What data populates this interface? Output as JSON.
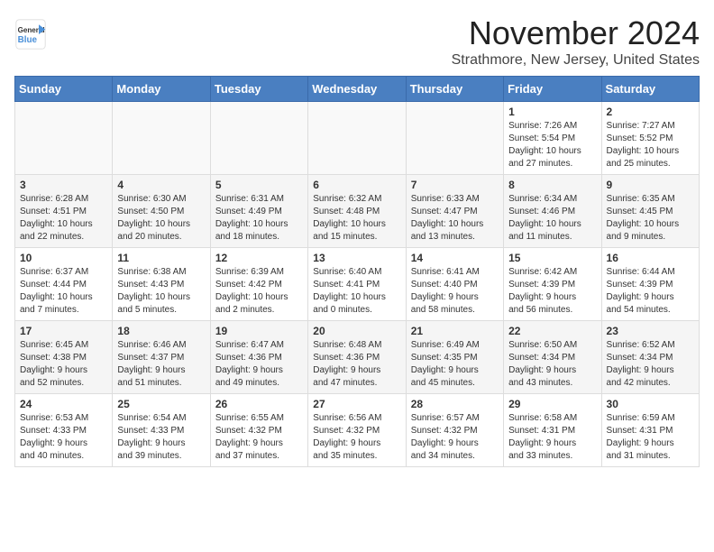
{
  "header": {
    "logo": {
      "line1": "General",
      "line2": "Blue"
    },
    "title": "November 2024",
    "subtitle": "Strathmore, New Jersey, United States"
  },
  "calendar": {
    "weekdays": [
      "Sunday",
      "Monday",
      "Tuesday",
      "Wednesday",
      "Thursday",
      "Friday",
      "Saturday"
    ],
    "weeks": [
      [
        {
          "day": "",
          "info": ""
        },
        {
          "day": "",
          "info": ""
        },
        {
          "day": "",
          "info": ""
        },
        {
          "day": "",
          "info": ""
        },
        {
          "day": "",
          "info": ""
        },
        {
          "day": "1",
          "info": "Sunrise: 7:26 AM\nSunset: 5:54 PM\nDaylight: 10 hours\nand 27 minutes."
        },
        {
          "day": "2",
          "info": "Sunrise: 7:27 AM\nSunset: 5:52 PM\nDaylight: 10 hours\nand 25 minutes."
        }
      ],
      [
        {
          "day": "3",
          "info": "Sunrise: 6:28 AM\nSunset: 4:51 PM\nDaylight: 10 hours\nand 22 minutes."
        },
        {
          "day": "4",
          "info": "Sunrise: 6:30 AM\nSunset: 4:50 PM\nDaylight: 10 hours\nand 20 minutes."
        },
        {
          "day": "5",
          "info": "Sunrise: 6:31 AM\nSunset: 4:49 PM\nDaylight: 10 hours\nand 18 minutes."
        },
        {
          "day": "6",
          "info": "Sunrise: 6:32 AM\nSunset: 4:48 PM\nDaylight: 10 hours\nand 15 minutes."
        },
        {
          "day": "7",
          "info": "Sunrise: 6:33 AM\nSunset: 4:47 PM\nDaylight: 10 hours\nand 13 minutes."
        },
        {
          "day": "8",
          "info": "Sunrise: 6:34 AM\nSunset: 4:46 PM\nDaylight: 10 hours\nand 11 minutes."
        },
        {
          "day": "9",
          "info": "Sunrise: 6:35 AM\nSunset: 4:45 PM\nDaylight: 10 hours\nand 9 minutes."
        }
      ],
      [
        {
          "day": "10",
          "info": "Sunrise: 6:37 AM\nSunset: 4:44 PM\nDaylight: 10 hours\nand 7 minutes."
        },
        {
          "day": "11",
          "info": "Sunrise: 6:38 AM\nSunset: 4:43 PM\nDaylight: 10 hours\nand 5 minutes."
        },
        {
          "day": "12",
          "info": "Sunrise: 6:39 AM\nSunset: 4:42 PM\nDaylight: 10 hours\nand 2 minutes."
        },
        {
          "day": "13",
          "info": "Sunrise: 6:40 AM\nSunset: 4:41 PM\nDaylight: 10 hours\nand 0 minutes."
        },
        {
          "day": "14",
          "info": "Sunrise: 6:41 AM\nSunset: 4:40 PM\nDaylight: 9 hours\nand 58 minutes."
        },
        {
          "day": "15",
          "info": "Sunrise: 6:42 AM\nSunset: 4:39 PM\nDaylight: 9 hours\nand 56 minutes."
        },
        {
          "day": "16",
          "info": "Sunrise: 6:44 AM\nSunset: 4:39 PM\nDaylight: 9 hours\nand 54 minutes."
        }
      ],
      [
        {
          "day": "17",
          "info": "Sunrise: 6:45 AM\nSunset: 4:38 PM\nDaylight: 9 hours\nand 52 minutes."
        },
        {
          "day": "18",
          "info": "Sunrise: 6:46 AM\nSunset: 4:37 PM\nDaylight: 9 hours\nand 51 minutes."
        },
        {
          "day": "19",
          "info": "Sunrise: 6:47 AM\nSunset: 4:36 PM\nDaylight: 9 hours\nand 49 minutes."
        },
        {
          "day": "20",
          "info": "Sunrise: 6:48 AM\nSunset: 4:36 PM\nDaylight: 9 hours\nand 47 minutes."
        },
        {
          "day": "21",
          "info": "Sunrise: 6:49 AM\nSunset: 4:35 PM\nDaylight: 9 hours\nand 45 minutes."
        },
        {
          "day": "22",
          "info": "Sunrise: 6:50 AM\nSunset: 4:34 PM\nDaylight: 9 hours\nand 43 minutes."
        },
        {
          "day": "23",
          "info": "Sunrise: 6:52 AM\nSunset: 4:34 PM\nDaylight: 9 hours\nand 42 minutes."
        }
      ],
      [
        {
          "day": "24",
          "info": "Sunrise: 6:53 AM\nSunset: 4:33 PM\nDaylight: 9 hours\nand 40 minutes."
        },
        {
          "day": "25",
          "info": "Sunrise: 6:54 AM\nSunset: 4:33 PM\nDaylight: 9 hours\nand 39 minutes."
        },
        {
          "day": "26",
          "info": "Sunrise: 6:55 AM\nSunset: 4:32 PM\nDaylight: 9 hours\nand 37 minutes."
        },
        {
          "day": "27",
          "info": "Sunrise: 6:56 AM\nSunset: 4:32 PM\nDaylight: 9 hours\nand 35 minutes."
        },
        {
          "day": "28",
          "info": "Sunrise: 6:57 AM\nSunset: 4:32 PM\nDaylight: 9 hours\nand 34 minutes."
        },
        {
          "day": "29",
          "info": "Sunrise: 6:58 AM\nSunset: 4:31 PM\nDaylight: 9 hours\nand 33 minutes."
        },
        {
          "day": "30",
          "info": "Sunrise: 6:59 AM\nSunset: 4:31 PM\nDaylight: 9 hours\nand 31 minutes."
        }
      ]
    ]
  }
}
